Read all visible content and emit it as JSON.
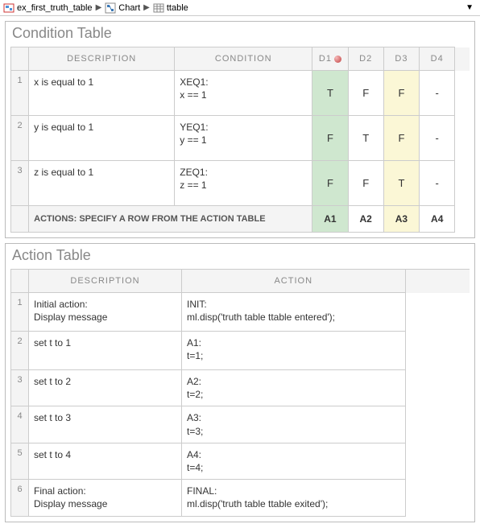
{
  "breadcrumb": {
    "items": [
      {
        "label": "ex_first_truth_table"
      },
      {
        "label": "Chart"
      },
      {
        "label": "ttable"
      }
    ]
  },
  "conditionTable": {
    "title": "Condition Table",
    "headers": {
      "description": "DESCRIPTION",
      "condition": "CONDITION",
      "d1": "D1",
      "d2": "D2",
      "d3": "D3",
      "d4": "D4"
    },
    "rows": [
      {
        "num": "1",
        "desc": "x is equal to 1",
        "label": "XEQ1:",
        "expr": "x == 1",
        "d": [
          "T",
          "F",
          "F",
          "-"
        ]
      },
      {
        "num": "2",
        "desc": "y is equal to 1",
        "label": "YEQ1:",
        "expr": "y == 1",
        "d": [
          "F",
          "T",
          "F",
          "-"
        ]
      },
      {
        "num": "3",
        "desc": "z is equal to 1",
        "label": "ZEQ1:",
        "expr": "z == 1",
        "d": [
          "F",
          "F",
          "T",
          "-"
        ]
      }
    ],
    "actionsLabel": "ACTIONS: SPECIFY A ROW FROM THE ACTION TABLE",
    "actions": [
      "A1",
      "A2",
      "A3",
      "A4"
    ]
  },
  "actionTable": {
    "title": "Action Table",
    "headers": {
      "description": "DESCRIPTION",
      "action": "ACTION"
    },
    "rows": [
      {
        "num": "1",
        "desc1": "Initial action:",
        "desc2": "Display message",
        "label": "INIT:",
        "code": "ml.disp('truth table ttable entered');"
      },
      {
        "num": "2",
        "desc1": "set t to 1",
        "desc2": "",
        "label": "A1:",
        "code": "t=1;"
      },
      {
        "num": "3",
        "desc1": "set t to 2",
        "desc2": "",
        "label": "A2:",
        "code": "t=2;"
      },
      {
        "num": "4",
        "desc1": "set t to 3",
        "desc2": "",
        "label": "A3:",
        "code": "t=3;"
      },
      {
        "num": "5",
        "desc1": "set t to 4",
        "desc2": "",
        "label": "A4:",
        "code": "t=4;"
      },
      {
        "num": "6",
        "desc1": "Final action:",
        "desc2": "Display message",
        "label": "FINAL:",
        "code": "ml.disp('truth table ttable exited');"
      }
    ]
  }
}
